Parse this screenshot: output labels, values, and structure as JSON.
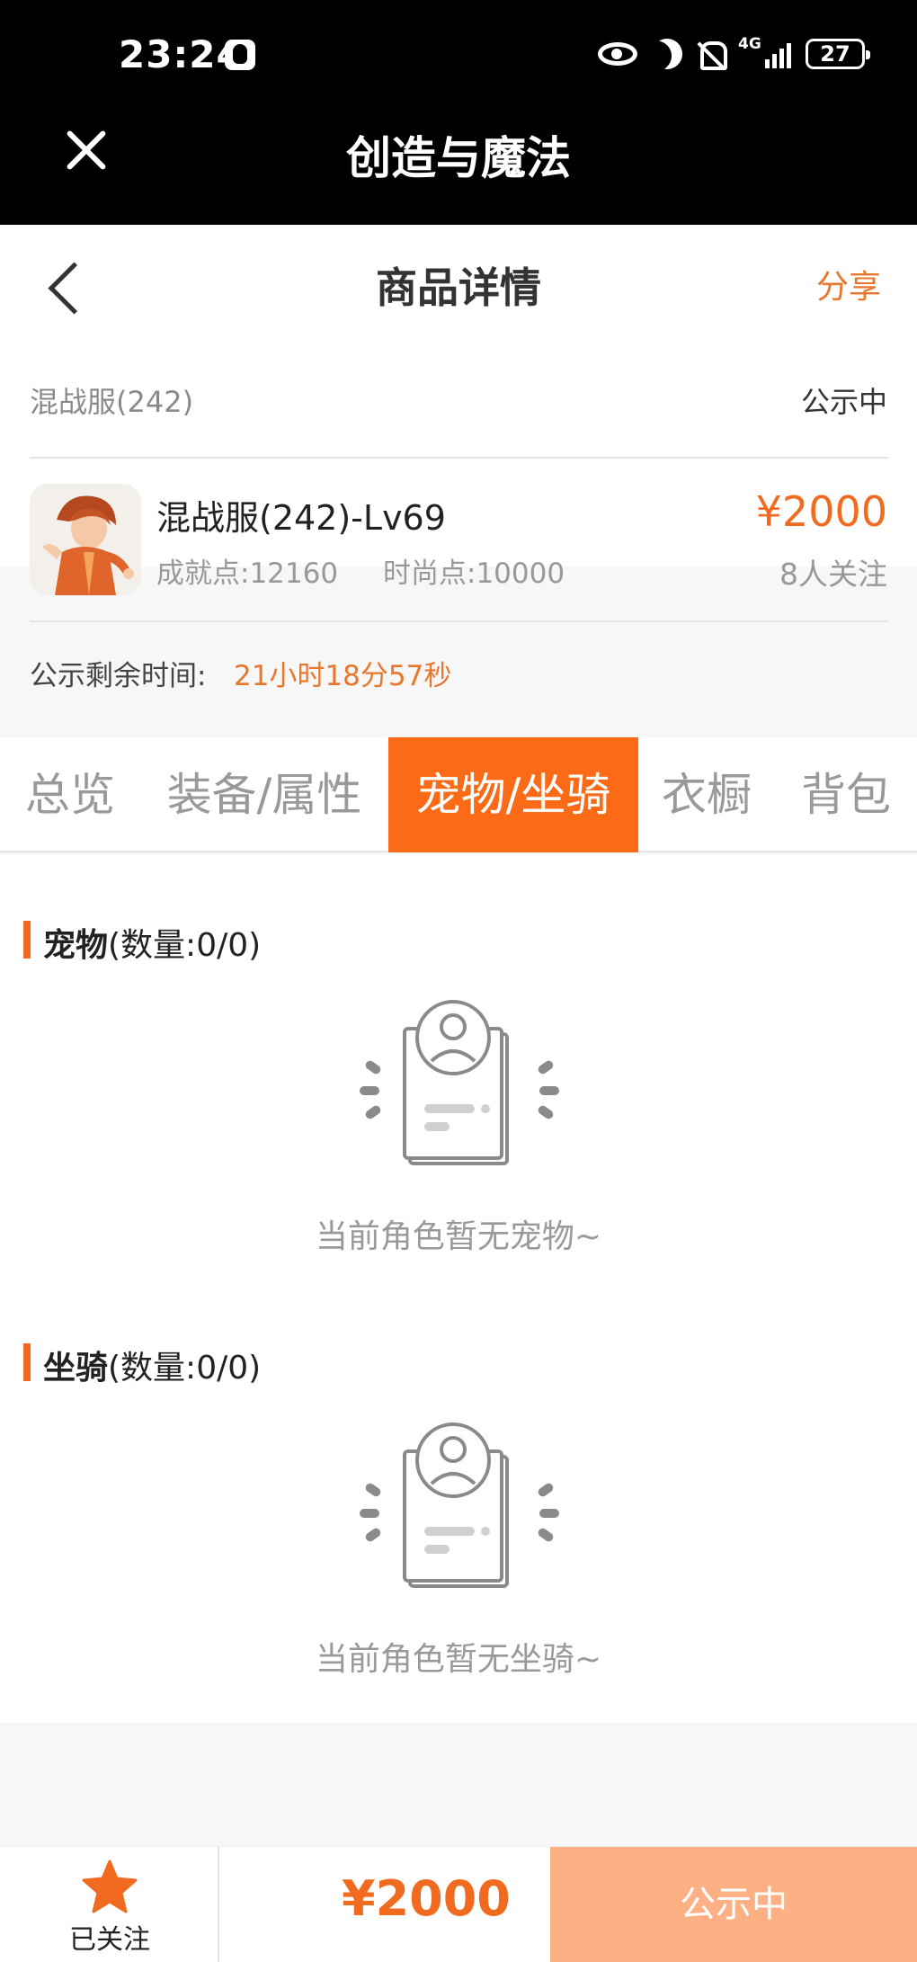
{
  "status_bar": {
    "time": "23:24",
    "signal_label": "4G",
    "battery": "27"
  },
  "app": {
    "title": "创造与魔法"
  },
  "header": {
    "title": "商品详情",
    "share_label": "分享"
  },
  "listing": {
    "server": "混战服(242)",
    "status": "公示中",
    "item_name": "混战服(242)-Lv69",
    "achievement_points": "成就点:12160",
    "fashion_points": "时尚点:10000",
    "price": "¥2000",
    "followers": "8人关注",
    "timer_label": "公示剩余时间:",
    "timer_value": "21小时18分57秒"
  },
  "tabs": [
    {
      "label": "总览",
      "active": false
    },
    {
      "label": "装备/属性",
      "active": false
    },
    {
      "label": "宠物/坐骑",
      "active": true
    },
    {
      "label": "衣橱",
      "active": false
    },
    {
      "label": "背包",
      "active": false
    }
  ],
  "sections": {
    "pets": {
      "title": "宠物",
      "count": "(数量:0/0)",
      "empty_text": "当前角色暂无宠物~"
    },
    "mounts": {
      "title": "坐骑",
      "count": "(数量:0/0)",
      "empty_text": "当前角色暂无坐骑~"
    }
  },
  "bottom_bar": {
    "follow_label": "已关注",
    "price": "¥2000",
    "status_button": "公示中"
  },
  "colors": {
    "accent": "#fb6a16",
    "price": "#f06b1f",
    "button_disabled": "#fcb083"
  },
  "icons": [
    "qq-icon",
    "eye-icon",
    "moon-icon",
    "mute-bell-icon",
    "signal-icon",
    "battery-icon",
    "close-icon",
    "back-chevron-icon",
    "empty-profile-icon",
    "star-icon"
  ]
}
